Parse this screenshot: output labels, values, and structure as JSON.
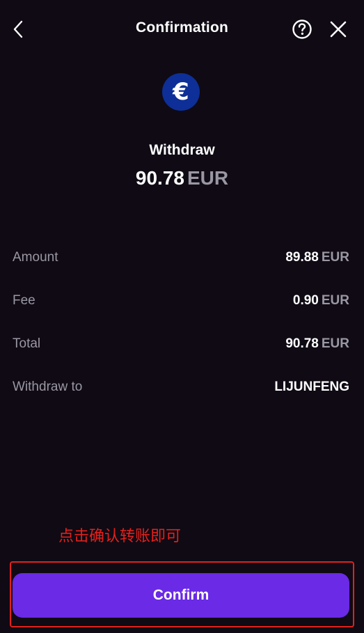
{
  "header": {
    "title": "Confirmation",
    "back_icon": "chevron-left-icon",
    "help_icon": "question-circle-icon",
    "close_icon": "close-icon"
  },
  "asset": {
    "icon": "euro-icon",
    "glyph": "€",
    "icon_color": "#0d2f97"
  },
  "summary": {
    "action": "Withdraw",
    "amount": "90.78",
    "unit": "EUR"
  },
  "details": [
    {
      "label": "Amount",
      "value": "89.88",
      "unit": "EUR"
    },
    {
      "label": "Fee",
      "value": "0.90",
      "unit": "EUR"
    },
    {
      "label": "Total",
      "value": "90.78",
      "unit": "EUR"
    },
    {
      "label": "Withdraw to",
      "value": "LIJUNFENG",
      "unit": ""
    }
  ],
  "annotation": {
    "text": "点击确认转账即可",
    "color": "#e5201b"
  },
  "confirm": {
    "label": "Confirm",
    "color": "#6a2ae6"
  },
  "colors": {
    "background": "#0f0a14",
    "muted_text": "#9a97a3",
    "text": "#ffffff"
  }
}
